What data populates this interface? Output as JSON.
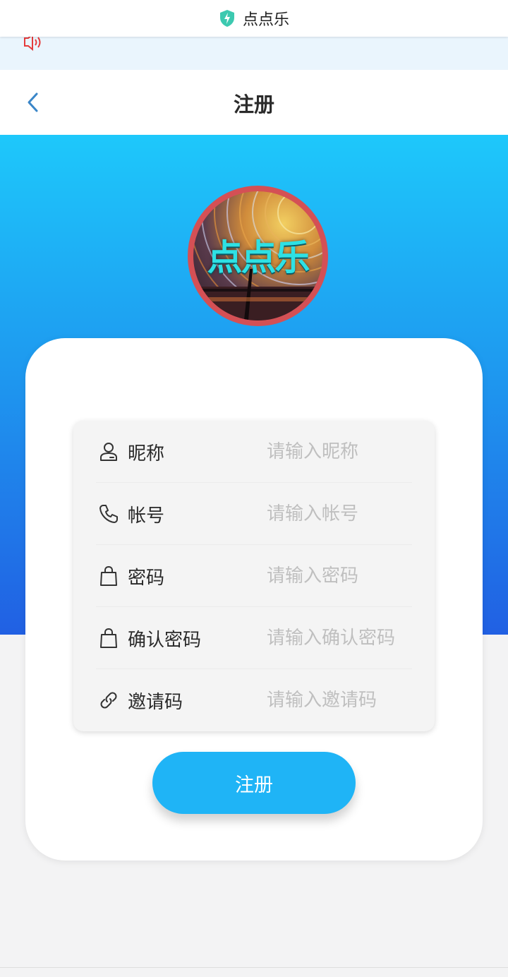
{
  "system_bar": {
    "app_name": "点点乐",
    "icon": "shield-bolt-icon"
  },
  "notice": {
    "icon": "speaker-icon"
  },
  "nav": {
    "title": "注册",
    "back_icon": "chevron-left-icon"
  },
  "logo": {
    "text": "点点乐"
  },
  "form": {
    "fields": [
      {
        "label": "昵称",
        "placeholder": "请输入昵称",
        "icon": "user-icon"
      },
      {
        "label": "帐号",
        "placeholder": "请输入帐号",
        "icon": "phone-icon"
      },
      {
        "label": "密码",
        "placeholder": "请输入密码",
        "icon": "bag-lock-icon"
      },
      {
        "label": "确认密码",
        "placeholder": "请输入确认密码",
        "icon": "bag-lock-icon"
      },
      {
        "label": "邀请码",
        "placeholder": "请输入邀请码",
        "icon": "link-icon"
      }
    ],
    "submit_label": "注册"
  },
  "colors": {
    "accent": "#1fb4f6",
    "hero_top": "#1ec8fb",
    "hero_bottom": "#2160e3",
    "avatar_border": "#d45055"
  }
}
